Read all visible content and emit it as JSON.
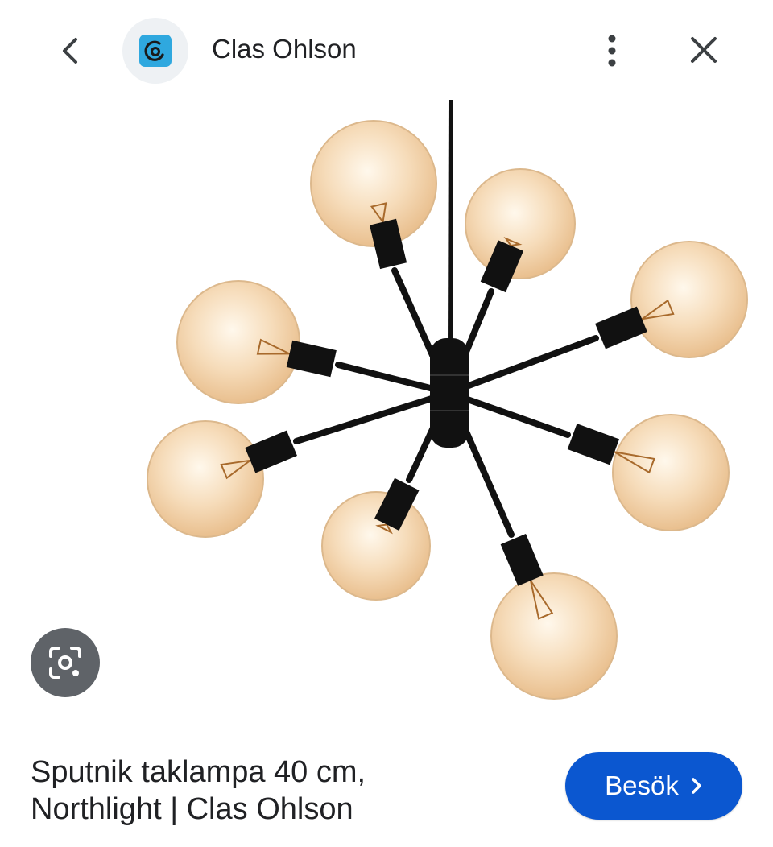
{
  "header": {
    "site_name": "Clas Ohlson",
    "icons": {
      "back": "chevron-left-icon",
      "logo": "clas-ohlson-logo",
      "more": "more-vert-icon",
      "close": "close-icon"
    }
  },
  "image": {
    "subject": "sputnik-pendant-lamp",
    "bulb_count": 8
  },
  "lens": {
    "icon": "google-lens-icon"
  },
  "result": {
    "title_line1": "Sputnik taklampa 40 cm,",
    "title_line2": "Northlight | Clas Ohlson",
    "visit_label": "Besök"
  },
  "colors": {
    "visit_button": "#0b57d0",
    "lens_button": "#5f6368",
    "logo_bg": "#2fa8df",
    "text": "#202124",
    "lamp_metal": "#111111",
    "bulb_amber": "#f3d2a8"
  }
}
